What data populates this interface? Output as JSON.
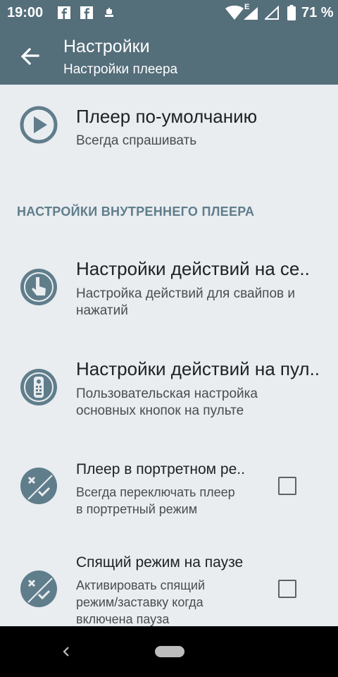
{
  "status_bar": {
    "time": "19:00",
    "network_label": "E",
    "battery": "71 %",
    "icons": [
      "facebook-icon",
      "facebook-icon",
      "notification-icon",
      "wifi-icon",
      "signal-icon",
      "signal-icon",
      "battery-icon"
    ]
  },
  "app_bar": {
    "title": "Настройки",
    "subtitle": "Настройки плеера"
  },
  "items": [
    {
      "title": "Плеер по-умолчанию",
      "summary": "Всегда спрашивать",
      "icon": "play-circle-icon"
    },
    {
      "title": "Настройки действий на се..",
      "summary_lines": [
        "Настройка действий для свайпов и",
        "нажатий"
      ],
      "icon": "touch-gesture-icon"
    },
    {
      "title": "Настройки действий на пул..",
      "summary_lines": [
        "Пользовательская настройка",
        "основных кнопок на пульте"
      ],
      "icon": "remote-control-icon"
    },
    {
      "title": "Плеер в портретном ре..",
      "summary_lines": [
        "Всегда переключать плеер",
        "в портретный режим"
      ],
      "icon": "toggle-check-icon",
      "checked": false
    },
    {
      "title": "Спящий режим на паузе",
      "summary_lines": [
        "Активировать спящий",
        "режим/заставку когда",
        "включена пауза"
      ],
      "icon": "toggle-check-icon",
      "checked": false
    }
  ],
  "section_header": "НАСТРОЙКИ ВНУТРЕННЕГО ПЛЕЕРА",
  "colors": {
    "app_bar": "#546e7a",
    "background": "#e9edf0",
    "icon": "#607d8b",
    "section_header": "#607d8b"
  }
}
